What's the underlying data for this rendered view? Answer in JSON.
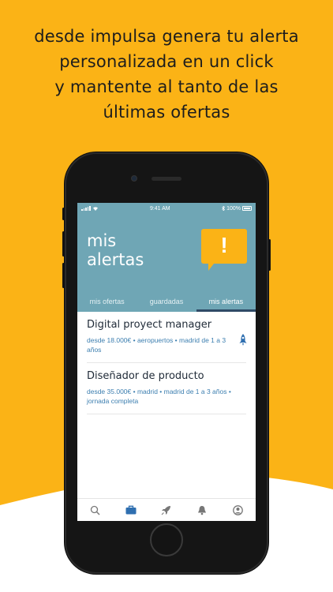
{
  "headline": {
    "line1": "desde impulsa genera tu alerta",
    "line2": "personalizada en un click",
    "line3": "y mantente al tanto de las",
    "line4": "últimas ofertas"
  },
  "status_bar": {
    "time": "9:41 AM",
    "battery": "100%"
  },
  "header": {
    "title_line1": "mis",
    "title_line2": "alertas",
    "bubble_glyph": "!"
  },
  "tabs": [
    {
      "label": "mis ofertas",
      "active": false
    },
    {
      "label": "guardadas",
      "active": false
    },
    {
      "label": "mis alertas",
      "active": true
    }
  ],
  "alerts": [
    {
      "title": "Digital proyect manager",
      "meta": "desde 18.000€ • aeropuertos • madrid de 1 a 3 años",
      "icon": "rocket-icon"
    },
    {
      "title": "Diseñador de producto",
      "meta": "desde 35.000€ • madrid • madrid de 1 a 3 años • jornada completa"
    }
  ],
  "navbar": [
    "search-icon",
    "briefcase-icon",
    "rocket-icon",
    "bell-icon",
    "profile-icon"
  ],
  "colors": {
    "background": "#fbb316",
    "header": "#6fa6b5",
    "accent_blue": "#2f6fb0",
    "tab_indicator": "#2f4a66"
  }
}
